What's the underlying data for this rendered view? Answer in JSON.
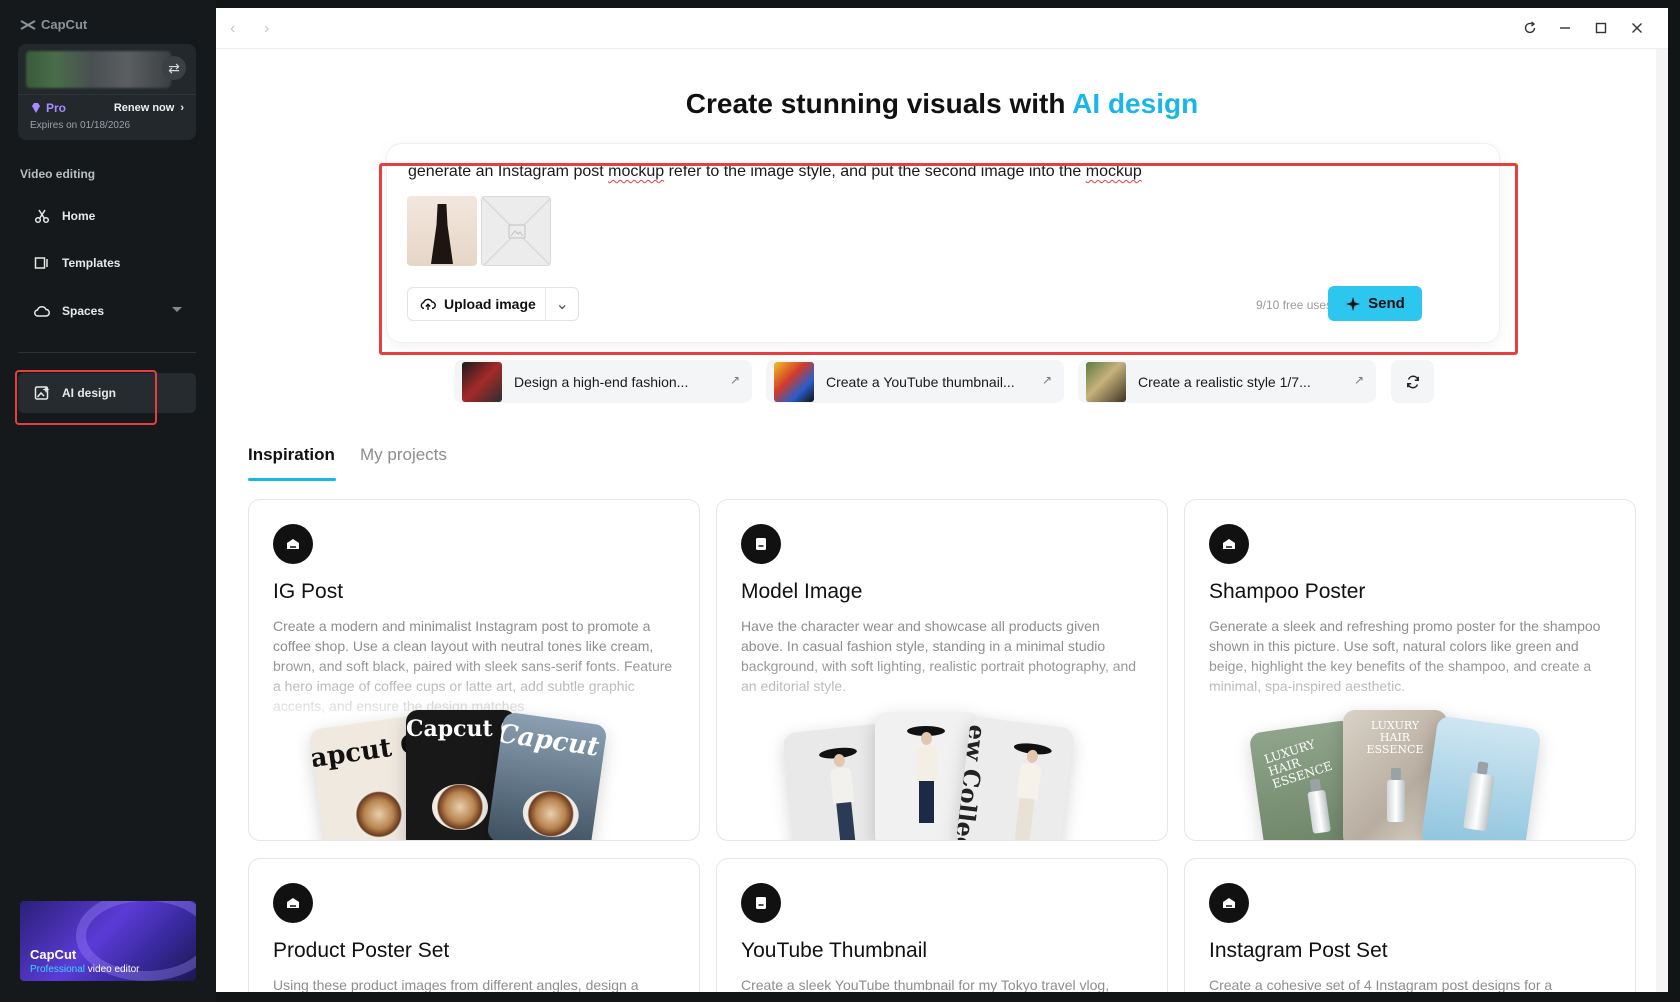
{
  "brand": {
    "name": "CapCut"
  },
  "account": {
    "plan": "Pro",
    "renew_label": "Renew now",
    "expires": "Expires on 01/18/2026"
  },
  "sidebar": {
    "section_title": "Video editing",
    "items": [
      {
        "label": "Home",
        "icon": "home-icon"
      },
      {
        "label": "Templates",
        "icon": "templates-icon"
      },
      {
        "label": "Spaces",
        "icon": "cloud-icon"
      },
      {
        "label": "AI design",
        "icon": "ai-design-icon"
      }
    ],
    "promo": {
      "title": "CapCut",
      "sub_accent": "Professional",
      "sub_rest": " video editor"
    }
  },
  "hero": {
    "title_main": "Create stunning visuals with ",
    "title_accent": "AI design"
  },
  "prompt": {
    "text_parts": [
      "generate an Instagram post ",
      "mockup",
      " refer to the image style, and put the second image into the ",
      "mockup"
    ],
    "upload_label": "Upload image",
    "free_uses": "9/10 free uses",
    "send_label": "Send"
  },
  "suggestions": [
    {
      "label": "Design a high-end fashion..."
    },
    {
      "label": "Create a YouTube thumbnail..."
    },
    {
      "label": "Create a realistic style 1/7..."
    }
  ],
  "tabs": {
    "inspiration": "Inspiration",
    "projects": "My projects"
  },
  "cards": [
    {
      "title": "IG Post",
      "desc": "Create a modern and minimalist Instagram post to promote a coffee shop. Use a clean layout with neutral tones like cream, brown, and soft black, paired with sleek sans-serif fonts. Feature a hero image of coffee cups or latte art, add subtle graphic accents, and ensure the design matches"
    },
    {
      "title": "Model Image",
      "desc": "Have the character wear and showcase all products given above. In casual fashion style, standing in a minimal studio background, with soft lighting, realistic portrait photography, and an editorial style."
    },
    {
      "title": "Shampoo Poster",
      "desc": "Generate a sleek and refreshing promo poster for the shampoo shown in this picture. Use soft, natural colors like green and beige, highlight the key benefits of the shampoo, and create a minimal, spa-inspired aesthetic."
    },
    {
      "title": "Product Poster Set",
      "desc": "Using these product images from different angles, design a"
    },
    {
      "title": "YouTube Thumbnail",
      "desc": "Create a sleek YouTube thumbnail for my Tokyo travel vlog,"
    },
    {
      "title": "Instagram Post Set",
      "desc": "Create a cohesive set of 4 Instagram post designs for a"
    }
  ],
  "mockups": {
    "ig_post": [
      "apcut C",
      "Capcut Ca",
      "Capcut Cafe"
    ],
    "model": [
      "ew",
      "Collecti"
    ],
    "shampoo": [
      "LUXURY",
      "HAIR ESSENCE",
      "LUXURY",
      "HAIR ESSENCE"
    ]
  },
  "colors": {
    "accent": "#19b6e9",
    "send": "#2cc6ef",
    "highlight": "#e5403f",
    "pro": "#a98bff"
  }
}
